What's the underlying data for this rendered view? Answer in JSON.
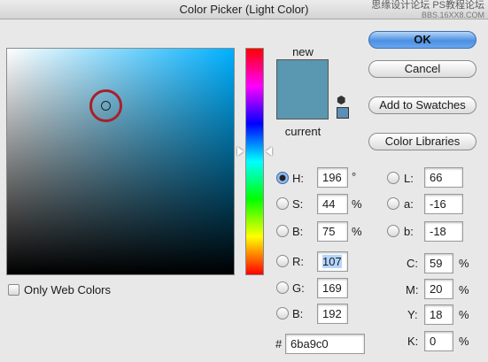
{
  "window": {
    "title": "Color Picker (Light Color)",
    "watermark_line1": "思缘设计论坛  PS教程论坛",
    "watermark_line2": "BBS.16XX8.COM"
  },
  "colors": {
    "new_color": "#5a97b0",
    "current_color": "#5a97b0",
    "web_safe_color": "#5a8fb6"
  },
  "preview": {
    "new_label": "new",
    "current_label": "current"
  },
  "buttons": {
    "ok": "OK",
    "cancel": "Cancel",
    "add_to_swatches": "Add to Swatches",
    "color_libraries": "Color Libraries"
  },
  "options": {
    "only_web_colors": "Only Web Colors"
  },
  "hsb": {
    "h_label": "H:",
    "h_value": "196",
    "h_unit": "°",
    "s_label": "S:",
    "s_value": "44",
    "s_unit": "%",
    "b_label": "B:",
    "b_value": "75",
    "b_unit": "%"
  },
  "rgb": {
    "r_label": "R:",
    "r_value": "107",
    "g_label": "G:",
    "g_value": "169",
    "b_label": "B:",
    "b_value": "192"
  },
  "lab": {
    "l_label": "L:",
    "l_value": "66",
    "a_label": "a:",
    "a_value": "-16",
    "b_label": "b:",
    "b_value": "-18"
  },
  "cmyk": {
    "c_label": "C:",
    "c_value": "59",
    "m_label": "M:",
    "m_value": "20",
    "y_label": "Y:",
    "y_value": "18",
    "k_label": "K:",
    "k_value": "0",
    "unit": "%"
  },
  "hex": {
    "label": "#",
    "value": "6ba9c0"
  },
  "icons": {
    "web_warning_icon": "cube-icon"
  }
}
